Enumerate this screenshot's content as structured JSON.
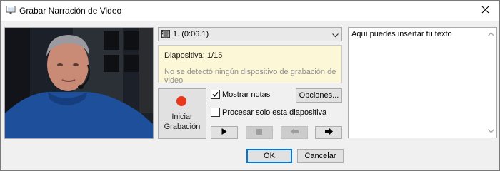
{
  "window": {
    "title": "Grabar Narración de Video"
  },
  "slide_selector": {
    "value": "1. (0:06.1)"
  },
  "info": {
    "slide_text": "Diapositiva: 1/15",
    "status_message": "No se detectó ningún dispositivo de grabación de video"
  },
  "record_button": {
    "line1": "Iniciar",
    "line2": "Grabación",
    "dot_color": "#e8371c"
  },
  "options": {
    "show_notes_label": "Mostrar notas",
    "show_notes_checked": true,
    "process_only_label": "Procesar solo esta diapositiva",
    "process_only_checked": false,
    "options_button_label": "Opciones..."
  },
  "playback": {
    "icons": [
      "play-icon",
      "stop-icon",
      "previous-icon",
      "next-icon"
    ]
  },
  "notes": {
    "text": "Aquí puedes insertar tu texto"
  },
  "footer": {
    "ok_label": "OK",
    "cancel_label": "Cancelar"
  },
  "colors": {
    "info_bg": "#fbf7d7",
    "ok_border": "#0078d7"
  }
}
